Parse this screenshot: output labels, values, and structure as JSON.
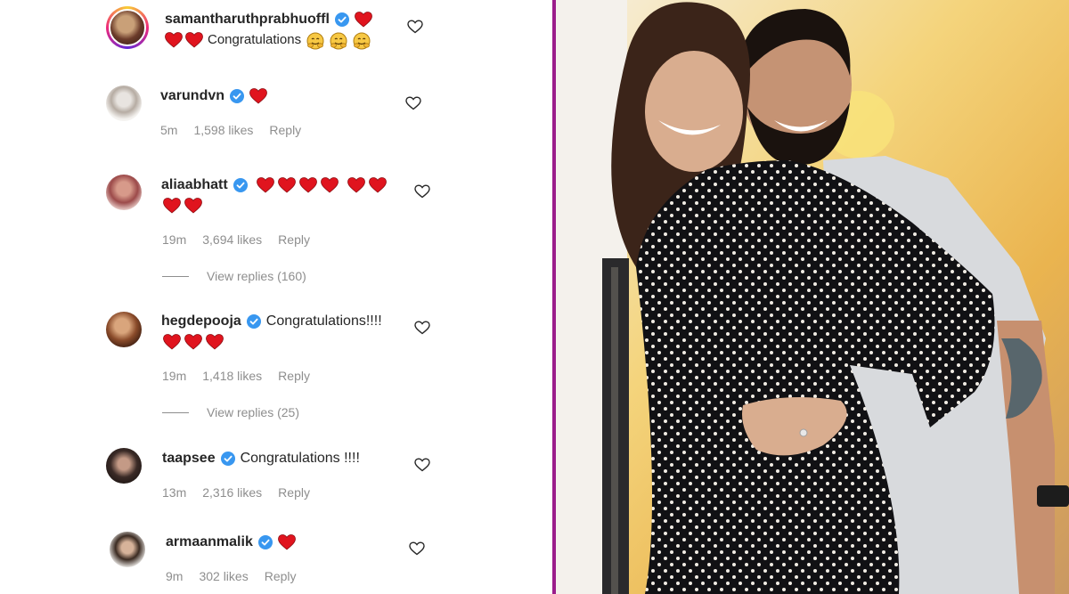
{
  "comments": [
    {
      "username": "samantharuthprabhuoffl",
      "verified": true,
      "text": "Congratulations",
      "hearts_line1": 1,
      "hearts_line2": 2,
      "emoji_count": 3
    },
    {
      "username": "varundvn",
      "verified": true,
      "hearts_line1": 1,
      "time": "5m",
      "likes": "1,598 likes",
      "reply": "Reply"
    },
    {
      "username": "aliaabhatt",
      "verified": true,
      "hearts_line1": 6,
      "hearts_line2": 2,
      "time": "19m",
      "likes": "3,694 likes",
      "reply": "Reply",
      "view_replies": "View replies (160)"
    },
    {
      "username": "hegdepooja",
      "verified": true,
      "text": "Congratulations!!!!",
      "hearts_line2": 3,
      "time": "19m",
      "likes": "1,418 likes",
      "reply": "Reply",
      "view_replies": "View replies (25)"
    },
    {
      "username": "taapsee",
      "verified": true,
      "text": "Congratulations !!!!",
      "time": "13m",
      "likes": "2,316 likes",
      "reply": "Reply"
    },
    {
      "username": "armaanmalik",
      "verified": true,
      "hearts_line1": 1,
      "time": "9m",
      "likes": "302 likes",
      "reply": "Reply"
    }
  ],
  "colors": {
    "heart": "#e0141e",
    "verified": "#3897f0",
    "divider": "#9b1d8b",
    "meta_text": "#8e8e8e"
  },
  "icons": {
    "verified": "verified-badge-icon",
    "heart_emoji": "red-heart-emoji",
    "like": "heart-outline-icon",
    "hug_emoji": "hugging-face-emoji"
  },
  "photo": {
    "description_label": ""
  }
}
